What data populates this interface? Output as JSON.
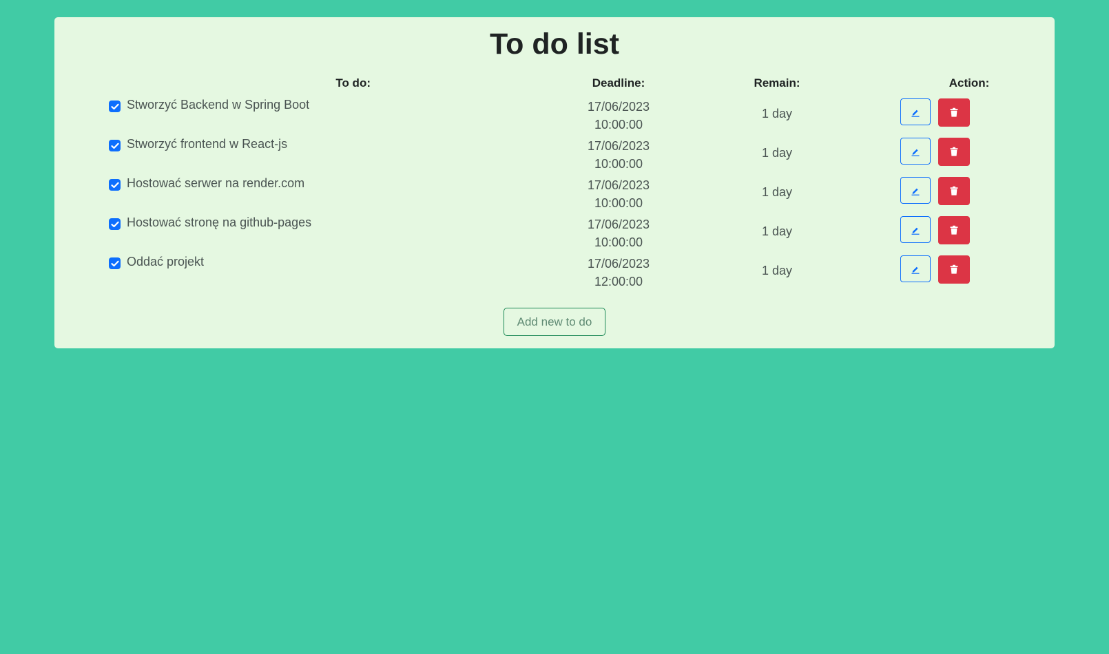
{
  "title": "To do list",
  "headers": {
    "todo": "To do:",
    "deadline": "Deadline:",
    "remain": "Remain:",
    "action": "Action:"
  },
  "todos": [
    {
      "task": "Stworzyć Backend w Spring Boot",
      "checked": true,
      "date": "17/06/2023",
      "time": "10:00:00",
      "remain": "1 day"
    },
    {
      "task": "Stworzyć frontend w React-js",
      "checked": true,
      "date": "17/06/2023",
      "time": "10:00:00",
      "remain": "1 day"
    },
    {
      "task": "Hostować serwer na render.com",
      "checked": true,
      "date": "17/06/2023",
      "time": "10:00:00",
      "remain": "1 day"
    },
    {
      "task": "Hostować stronę na github-pages",
      "checked": true,
      "date": "17/06/2023",
      "time": "10:00:00",
      "remain": "1 day"
    },
    {
      "task": "Oddać projekt",
      "checked": true,
      "date": "17/06/2023",
      "time": "12:00:00",
      "remain": "1 day"
    }
  ],
  "add_button_label": "Add new to do",
  "icons": {
    "edit": "pencil-icon",
    "delete": "trash-icon",
    "checkbox": "check-icon"
  },
  "colors": {
    "background": "#41cba5",
    "card": "#e5f8e1",
    "edit_border": "#0d6efd",
    "delete_bg": "#dc3545",
    "add_border": "#198754",
    "checkbox": "#0d6efd"
  }
}
